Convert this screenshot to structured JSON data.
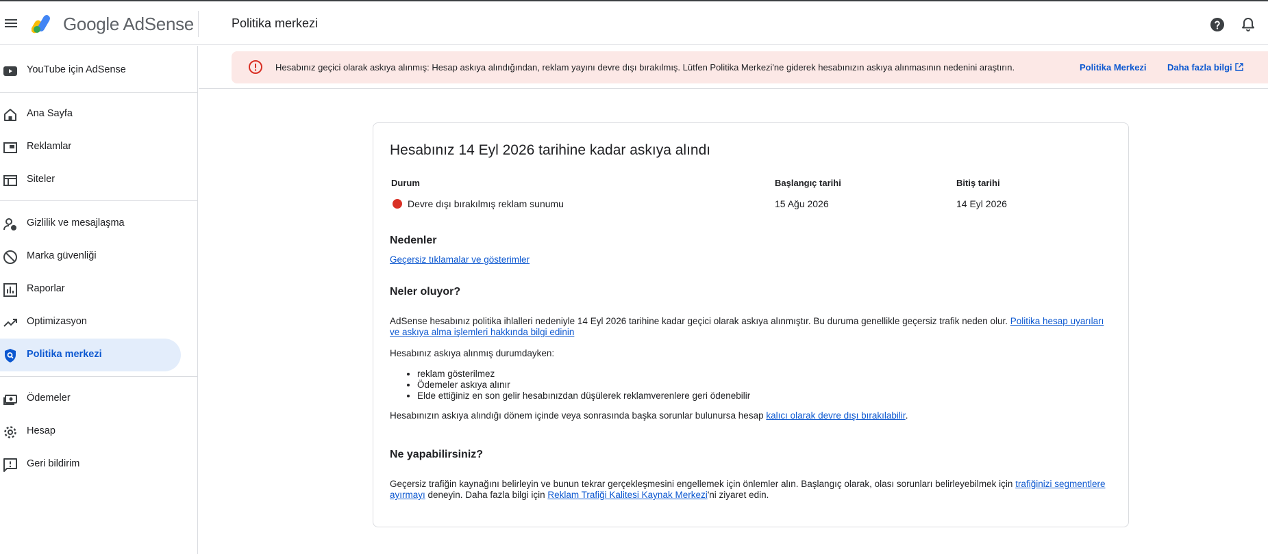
{
  "header": {
    "brand_google": "Google",
    "brand_product": "AdSense",
    "page_title": "Politika merkezi",
    "help_icon": "help-circle-icon",
    "notifications_icon": "bell-icon"
  },
  "sidebar": {
    "items": [
      {
        "label": "YouTube için AdSense",
        "icon": "youtube-icon"
      },
      {
        "label": "Ana Sayfa",
        "icon": "home-icon"
      },
      {
        "label": "Reklamlar",
        "icon": "ads-icon"
      },
      {
        "label": "Siteler",
        "icon": "sites-icon"
      },
      {
        "label": "Gizlilik ve mesajlaşma",
        "icon": "privacy-icon"
      },
      {
        "label": "Marka güvenliği",
        "icon": "block-icon"
      },
      {
        "label": "Raporlar",
        "icon": "reports-icon"
      },
      {
        "label": "Optimizasyon",
        "icon": "trending-icon"
      },
      {
        "label": "Politika merkezi",
        "icon": "policy-shield-icon",
        "active": true
      },
      {
        "label": "Ödemeler",
        "icon": "payments-icon"
      },
      {
        "label": "Hesap",
        "icon": "gear-icon"
      },
      {
        "label": "Geri bildirim",
        "icon": "feedback-icon"
      }
    ]
  },
  "alert": {
    "text": "Hesabınız geçici olarak askıya alınmış: Hesap askıya alındığından, reklam yayını devre dışı bırakılmış. Lütfen Politika Merkezi'ne giderek hesabınızın askıya alınmasının nedenini araştırın.",
    "link_policy": "Politika Merkezi",
    "link_more": "Daha fazla bilgi",
    "color_bg": "#fce8e6",
    "color_icon": "#d93025"
  },
  "card": {
    "title": "Hesabınız 14 Eyl 2026 tarihine kadar askıya alındı",
    "table": {
      "headers": [
        "Durum",
        "Başlangıç tarihi",
        "Bitiş tarihi"
      ],
      "row": {
        "status": "Devre dışı bırakılmış reklam sunumu",
        "start": "15 Ağu 2026",
        "end": "14 Eyl 2026"
      }
    },
    "reasons_heading": "Nedenler",
    "reasons_link": "Geçersiz tıklamalar ve gösterimler",
    "what_heading": "Neler oluyor?",
    "what_text": "AdSense hesabınız politika ihlalleri nedeniyle 14 Eyl 2026 tarihine kadar geçici olarak askıya alınmıştır. Bu duruma genellikle geçersiz trafik neden olur. ",
    "what_link": "Politika hesap uyarıları ve askıya alma işlemleri hakkında bilgi edinin",
    "while_text": "Hesabınız askıya alınmış durumdayken:",
    "bullets": [
      "reklam gösterilmez",
      "Ödemeler askıya alınır",
      "Elde ettiğiniz en son gelir hesabınızdan düşülerek reklamverenlere geri ödenebilir"
    ],
    "further_text": "Hesabınızın askıya alındığı dönem içinde veya sonrasında başka sorunlar bulunursa hesap ",
    "further_link": "kalıcı olarak devre dışı bırakılabilir",
    "further_end": ".",
    "todo_heading": "Ne yapabilirsiniz?",
    "todo_text1": "Geçersiz trafiğin kaynağını belirleyin ve bunun tekrar gerçekleşmesini engellemek için önlemler alın. Başlangıç olarak, olası sorunları belirleyebilmek için ",
    "todo_link1": "trafiğinizi segmentlere ayırmayı",
    "todo_text2": " deneyin. Daha fazla bilgi için ",
    "todo_link2": "Reklam Trafiği Kalitesi Kaynak Merkezi",
    "todo_text3": "'ni ziyaret edin."
  },
  "colors": {
    "accent": "#0b57d0",
    "active_bg": "#e3edfb",
    "status_red": "#d93025"
  }
}
